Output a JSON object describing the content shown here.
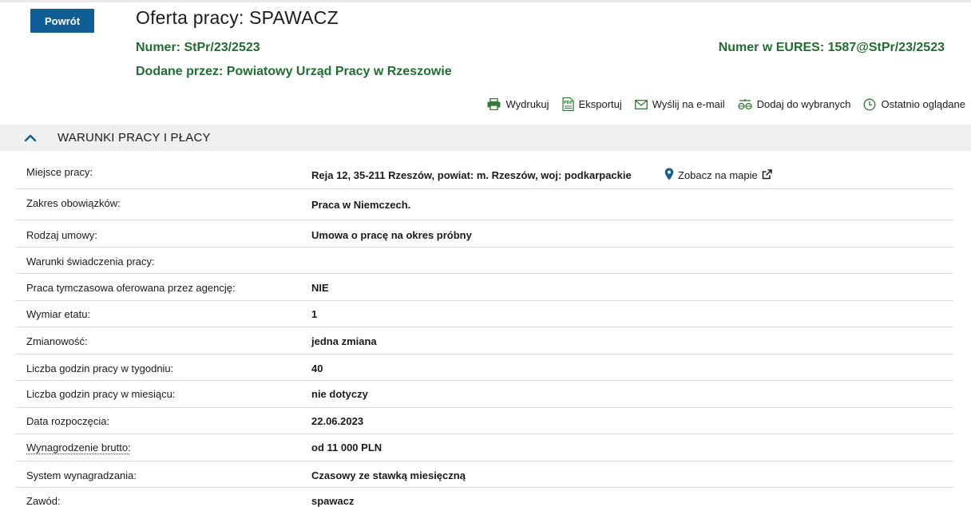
{
  "header": {
    "back_label": "Powrót",
    "title": "Oferta pracy: SPAWACZ",
    "number_label": "Numer:",
    "number_value": "StPr/23/2523",
    "added_label": "Dodane przez:",
    "added_value": "Powiatowy Urząd Pracy w Rzeszowie",
    "eures_label": "Numer w EURES:",
    "eures_value": "1587@StPr/23/2523"
  },
  "actions": [
    {
      "label": "Wydrukuj",
      "icon": "printer-icon"
    },
    {
      "label": "Eksportuj",
      "icon": "pdf-icon"
    },
    {
      "label": "Wyślij na e-mail",
      "icon": "mail-icon"
    },
    {
      "label": "Dodaj do wybranych",
      "icon": "scales-icon"
    },
    {
      "label": "Ostatnio oglądane",
      "icon": "clock-icon"
    }
  ],
  "section": {
    "title": "WARUNKI PRACY I PŁACY"
  },
  "rows": [
    {
      "key": "Miejsce pracy:",
      "value": "Reja 12, 35-211 Rzeszów, powiat: m. Rzeszów, woj: podkarpackie"
    },
    {
      "key": "Zakres obowiązków:",
      "value": "Praca w Niemczech."
    },
    {
      "key": "Rodzaj umowy:",
      "value": "Umowa o pracę na okres próbny"
    },
    {
      "key": "Warunki świadczenia pracy:",
      "value": ""
    },
    {
      "key": "Praca tymczasowa oferowana przez agencję:",
      "value": "NIE"
    },
    {
      "key": "Wymiar etatu:",
      "value": "1"
    },
    {
      "key": "Zmianowość:",
      "value": "jedna zmiana"
    },
    {
      "key": "Liczba godzin pracy w tygodniu:",
      "value": "40"
    },
    {
      "key": "Liczba godzin pracy w miesiącu:",
      "value": "nie dotyczy"
    },
    {
      "key": "Data rozpoczęcia:",
      "value": "22.06.2023"
    },
    {
      "key": "Wynagrodzenie brutto:",
      "value": "od 11 000 PLN"
    },
    {
      "key": "System wynagradzania:",
      "value": "Czasowy ze stawką miesięczną"
    },
    {
      "key": "Zawód:",
      "value": "spawacz"
    }
  ],
  "map_link": {
    "label": "Zobacz na mapie",
    "icon": "map-pin-icon",
    "external_icon": "external-link-icon"
  },
  "colors": {
    "primary_button": "#0f5f96",
    "accent_green": "#1f6f2e",
    "icon_green": "#2e7d32",
    "section_bg": "#efefef",
    "chevron": "#0f5f96",
    "map_pin": "#0f5f96"
  }
}
